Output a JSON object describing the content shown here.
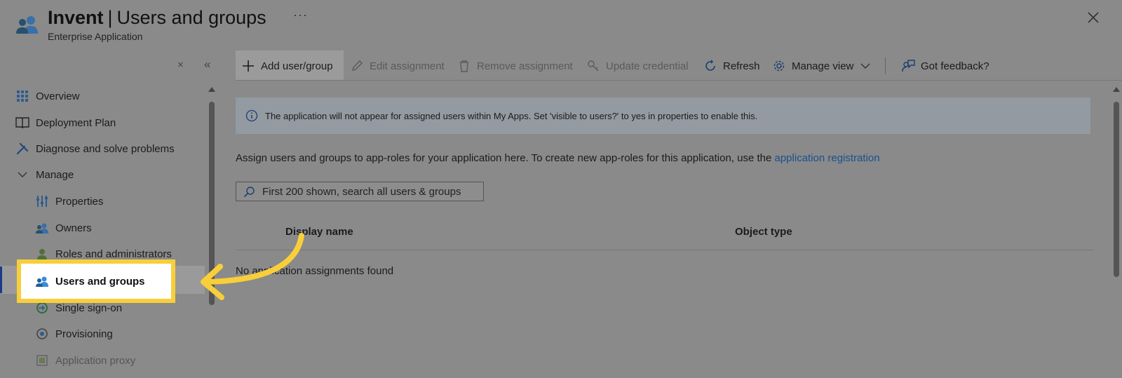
{
  "header": {
    "app_name": "Invent",
    "separator": "|",
    "page_title": "Users and groups",
    "subtitle": "Enterprise Application",
    "more_label": "···",
    "close_label": "close"
  },
  "sidebar": {
    "collapse_label": "×",
    "double_chevron_label": "«",
    "items": [
      {
        "label": "Overview",
        "icon": "grid-icon"
      },
      {
        "label": "Deployment Plan",
        "icon": "book-icon"
      },
      {
        "label": "Diagnose and solve problems",
        "icon": "wrench-icon"
      },
      {
        "label": "Manage",
        "icon": "chevron-down-icon"
      },
      {
        "label": "Properties",
        "icon": "properties-icon"
      },
      {
        "label": "Owners",
        "icon": "owners-icon"
      },
      {
        "label": "Roles and administrators",
        "icon": "roles-icon"
      },
      {
        "label": "Users and groups",
        "icon": "users-icon"
      },
      {
        "label": "Single sign-on",
        "icon": "sso-icon"
      },
      {
        "label": "Provisioning",
        "icon": "provisioning-icon"
      },
      {
        "label": "Application proxy",
        "icon": "proxy-icon"
      }
    ],
    "selected_index": 7
  },
  "toolbar": {
    "add": "Add user/group",
    "edit": "Edit assignment",
    "remove": "Remove assignment",
    "update": "Update credential",
    "refresh": "Refresh",
    "manage_view": "Manage view",
    "feedback": "Got feedback?"
  },
  "main": {
    "info": "The application will not appear for assigned users within My Apps. Set 'visible to users?' to yes in properties to enable this.",
    "description": "Assign users and groups to app-roles for your application here. To create new app-roles for this application, use the ",
    "description_link": "application registration",
    "search_placeholder": "First 200 shown, search all users & groups",
    "columns": [
      "Display name",
      "Object type"
    ],
    "empty_message": "No application assignments found"
  },
  "colors": {
    "accent": "#1b4f8e",
    "highlight": "#f8cf3b",
    "overlay": "#8a8a8a"
  }
}
